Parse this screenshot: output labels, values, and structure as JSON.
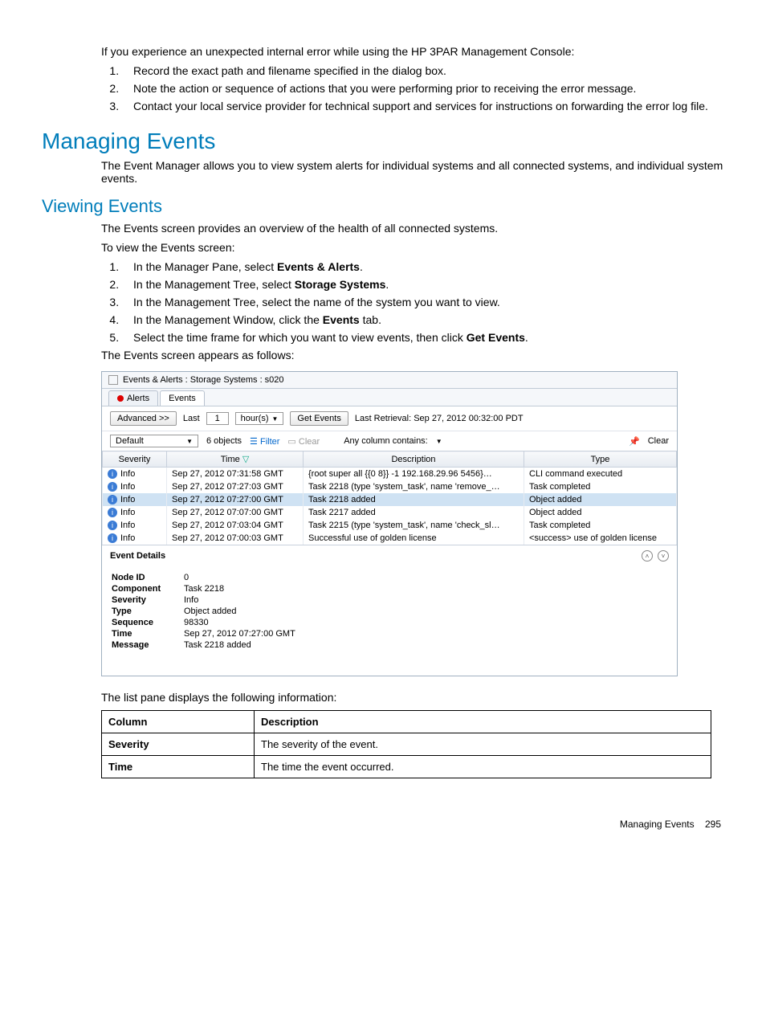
{
  "intro": {
    "lead": "If you experience an unexpected internal error while using the HP 3PAR Management Console:",
    "items": [
      "Record the exact path and filename specified in the dialog box.",
      "Note the action or sequence of actions that you were performing prior to receiving the error message.",
      "Contact your local service provider for technical support and services for instructions on forwarding the error log file."
    ]
  },
  "h1": "Managing Events",
  "p1": "The Event Manager allows you to view system alerts for individual systems and all connected systems, and individual system events.",
  "h2": "Viewing Events",
  "p2": "The Events screen provides an overview of the health of all connected systems.",
  "p3": "To view the Events screen:",
  "steps": [
    {
      "pre": "In the Manager Pane, select ",
      "bold": "Events & Alerts",
      "post": "."
    },
    {
      "pre": "In the Management Tree, select ",
      "bold": "Storage Systems",
      "post": "."
    },
    {
      "pre": "In the Management Tree, select the name of the system you want to view.",
      "bold": "",
      "post": ""
    },
    {
      "pre": "In the Management Window, click the ",
      "bold": "Events",
      "post": " tab."
    },
    {
      "pre": "Select the time frame for which you want to view events, then click ",
      "bold": "Get Events",
      "post": "."
    }
  ],
  "p4": "The Events screen appears as follows:",
  "shot": {
    "title": "Events & Alerts : Storage Systems : s020",
    "tabs": {
      "alerts": "Alerts",
      "events": "Events"
    },
    "advanced": "Advanced >>",
    "last": "Last",
    "last_val": "1",
    "unit": "hour(s)",
    "getevents": "Get Events",
    "lastret": "Last Retrieval: Sep 27, 2012 00:32:00 PDT",
    "default": "Default",
    "objcount": "6 objects",
    "filter": "Filter",
    "clear1": "Clear",
    "anycol": "Any column contains:",
    "clear2": "Clear",
    "cols": {
      "sev": "Severity",
      "time": "Time",
      "desc": "Description",
      "type": "Type"
    },
    "rows": [
      {
        "sev": "Info",
        "time": "Sep 27, 2012 07:31:58 GMT",
        "desc": "{root super all {{0 8}} -1 192.168.29.96 5456}…",
        "type": "CLI command executed"
      },
      {
        "sev": "Info",
        "time": "Sep 27, 2012 07:27:03 GMT",
        "desc": "Task 2218 (type 'system_task', name 'remove_…",
        "type": "Task completed"
      },
      {
        "sev": "Info",
        "time": "Sep 27, 2012 07:27:00 GMT",
        "desc": "Task 2218 added",
        "type": "Object added",
        "sel": true
      },
      {
        "sev": "Info",
        "time": "Sep 27, 2012 07:07:00 GMT",
        "desc": "Task 2217 added",
        "type": "Object added"
      },
      {
        "sev": "Info",
        "time": "Sep 27, 2012 07:03:04 GMT",
        "desc": "Task 2215 (type 'system_task', name 'check_sl…",
        "type": "Task completed"
      },
      {
        "sev": "Info",
        "time": "Sep 27, 2012 07:00:03 GMT",
        "desc": "Successful use of golden license",
        "type": "<success> use of golden license"
      }
    ],
    "details": {
      "title": "Event Details",
      "kv": [
        {
          "k": "Node ID",
          "v": "0"
        },
        {
          "k": "Component",
          "v": "Task 2218"
        },
        {
          "k": "Severity",
          "v": "Info"
        },
        {
          "k": "Type",
          "v": "Object added"
        },
        {
          "k": "Sequence",
          "v": "98330"
        },
        {
          "k": "Time",
          "v": "Sep 27, 2012 07:27:00 GMT"
        },
        {
          "k": "Message",
          "v": "Task 2218 added"
        }
      ]
    }
  },
  "p5": "The list pane displays the following information:",
  "coltbl": {
    "head": {
      "c": "Column",
      "d": "Description"
    },
    "rows": [
      {
        "c": "Severity",
        "d": "The severity of the event."
      },
      {
        "c": "Time",
        "d": "The time the event occurred."
      }
    ]
  },
  "footer": {
    "label": "Managing Events",
    "page": "295"
  }
}
